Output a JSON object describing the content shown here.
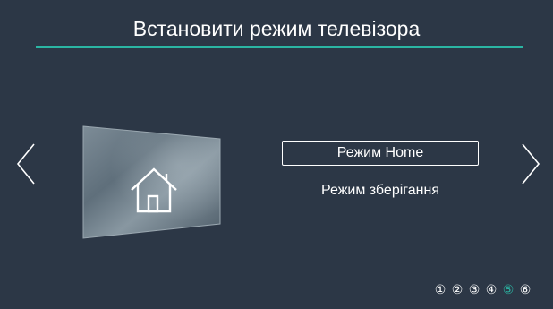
{
  "header": {
    "title": "Встановити режим телевізора"
  },
  "navigation": {
    "prev_icon": "chevron-left-icon",
    "next_icon": "chevron-right-icon"
  },
  "preview": {
    "icon": "home-icon"
  },
  "options": {
    "selected": "Режим Home",
    "other": "Режим зберігання"
  },
  "steps": {
    "items": [
      "①",
      "②",
      "③",
      "④",
      "⑤",
      "⑥"
    ],
    "current": 5
  },
  "colors": {
    "background": "#2c3746",
    "accent": "#2bb5a3",
    "text": "#ffffff"
  }
}
